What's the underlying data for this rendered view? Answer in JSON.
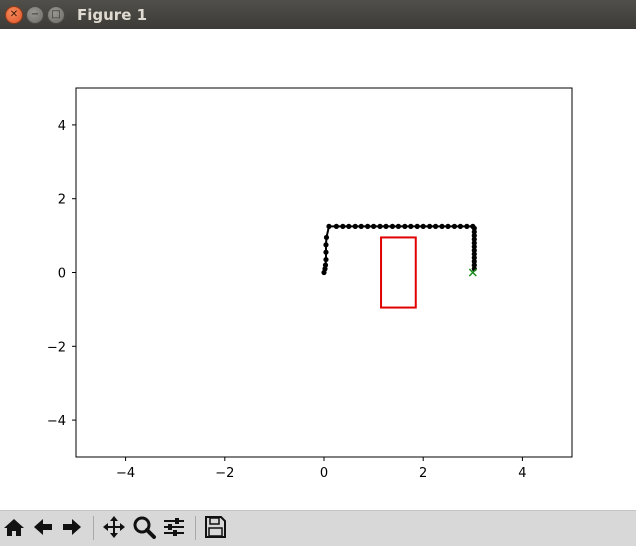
{
  "window": {
    "title": "Figure 1"
  },
  "chart_data": {
    "type": "line",
    "xlim": [
      -5,
      5
    ],
    "ylim": [
      -5,
      5
    ],
    "xticks": [
      -4,
      -2,
      0,
      2,
      4
    ],
    "yticks": [
      -4,
      -2,
      0,
      2,
      4
    ],
    "xtick_labels": [
      "−4",
      "−2",
      "0",
      "2",
      "4"
    ],
    "ytick_labels": [
      "−4",
      "−2",
      "0",
      "2",
      "4"
    ],
    "grid": false,
    "series": [
      {
        "color": "#000000",
        "marker": "dot",
        "x": [
          0,
          0.02,
          0.03,
          0.04,
          0.04,
          0.04,
          0.05,
          0.1,
          0.25,
          0.38,
          0.5,
          0.63,
          0.75,
          0.88,
          1.0,
          1.13,
          1.25,
          1.38,
          1.5,
          1.63,
          1.75,
          1.88,
          2.0,
          2.13,
          2.25,
          2.38,
          2.5,
          2.63,
          2.75,
          2.88,
          3.0,
          3.03,
          3.03,
          3.03,
          3.03,
          3.03,
          3.03,
          3.03,
          3.03,
          3.03,
          3.03,
          3.03,
          3.03
        ],
        "y": [
          0,
          0.1,
          0.2,
          0.35,
          0.55,
          0.75,
          0.95,
          1.25,
          1.25,
          1.25,
          1.25,
          1.25,
          1.25,
          1.25,
          1.25,
          1.25,
          1.25,
          1.25,
          1.25,
          1.25,
          1.25,
          1.25,
          1.25,
          1.25,
          1.25,
          1.25,
          1.25,
          1.25,
          1.25,
          1.25,
          1.25,
          1.2,
          1.1,
          1.0,
          0.9,
          0.8,
          0.7,
          0.6,
          0.5,
          0.4,
          0.3,
          0.2,
          0.1
        ]
      }
    ],
    "rectangle": {
      "color": "#e00000",
      "x0": 1.15,
      "y0": -0.95,
      "x1": 1.85,
      "y1": 0.95
    },
    "goal_marker": {
      "color": "#1a8a1a",
      "marker": "x",
      "x": 3.0,
      "y": 0.0
    }
  },
  "toolbar": {
    "buttons": [
      {
        "name": "home-icon",
        "glyph": "⌂"
      },
      {
        "name": "back-arrow-icon",
        "glyph": "←"
      },
      {
        "name": "forward-arrow-icon",
        "glyph": "→"
      },
      {
        "name": "pan-icon",
        "glyph": "✥"
      },
      {
        "name": "zoom-icon",
        "glyph": "🔍"
      },
      {
        "name": "subplots-config-icon",
        "glyph": "☰"
      },
      {
        "name": "save-icon",
        "glyph": "💾"
      }
    ]
  }
}
